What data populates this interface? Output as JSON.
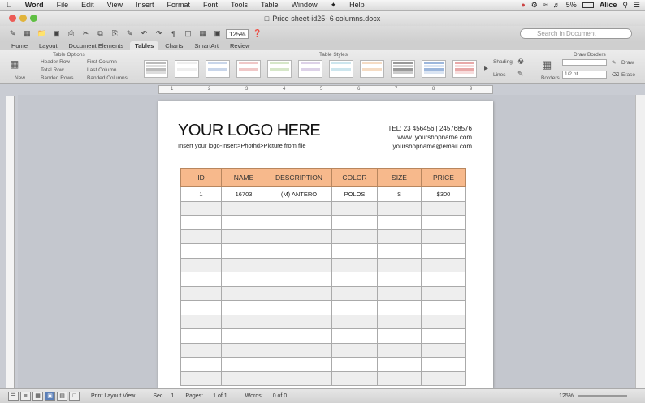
{
  "menubar": {
    "app": "Word",
    "items": [
      "File",
      "Edit",
      "View",
      "Insert",
      "Format",
      "Font",
      "Tools",
      "Table",
      "Window",
      "Help"
    ],
    "battery": "5%",
    "user": "Alice"
  },
  "window": {
    "title": "Price sheet-id25- 6 columns.docx"
  },
  "toolbar": {
    "zoom": "125%",
    "search_placeholder": "Search in Document"
  },
  "ribbon_tabs": [
    "Home",
    "Layout",
    "Document Elements",
    "Tables",
    "Charts",
    "SmartArt",
    "Review"
  ],
  "ribbon": {
    "table_options": "Table Options",
    "new": "New",
    "header_row": "Header Row",
    "first_column": "First Column",
    "total_row": "Total Row",
    "last_column": "Last Column",
    "banded_rows": "Banded Rows",
    "banded_columns": "Banded Columns",
    "table_styles": "Table Styles",
    "shading": "Shading",
    "lines": "Lines",
    "draw_borders": "Draw Borders",
    "borders": "Borders",
    "pt": "1/2 pt",
    "draw": "Draw",
    "erase": "Erase"
  },
  "document": {
    "logo": "YOUR LOGO HERE",
    "subtitle": "Insert your logo-Insert>Phothd>Picture from file",
    "tel": "TEL: 23 456456  |  245768576",
    "web": "www. yourshopname.com",
    "email": "yourshopname@email.com"
  },
  "table": {
    "headers": [
      "ID",
      "NAME",
      "DESCRIPTION",
      "COLOR",
      "SIZE",
      "PRICE"
    ],
    "row1": [
      "1",
      "16703",
      "(M) ANTERO",
      "POLOS",
      "S",
      "$300"
    ]
  },
  "status": {
    "view": "Print Layout View",
    "sec": "Sec",
    "sec_val": "1",
    "pages": "Pages:",
    "pages_val": "1 of 1",
    "words": "Words:",
    "words_val": "0 of 0",
    "zoom": "125%"
  }
}
